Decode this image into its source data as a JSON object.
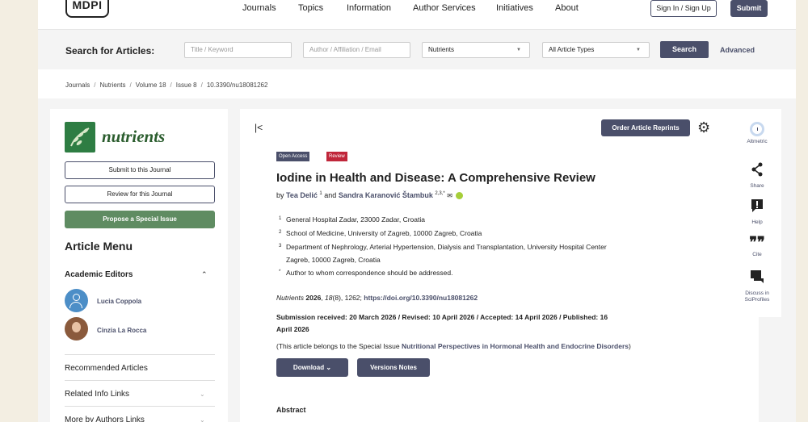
{
  "nav": {
    "logo": "MDPI",
    "links": [
      "Journals",
      "Topics",
      "Information",
      "Author Services",
      "Initiatives",
      "About"
    ],
    "sign_in": "Sign In / Sign Up",
    "submit": "Submit"
  },
  "search": {
    "label": "Search for Articles:",
    "keyword_placeholder": "Title / Keyword",
    "author_placeholder": "Author / Affiliation / Email",
    "journal_value": "Nutrients",
    "type_value": "All Article Types",
    "search_button": "Search",
    "advanced": "Advanced"
  },
  "breadcrumb": [
    "Journals",
    "Nutrients",
    "Volume 18",
    "Issue 8",
    "10.3390/nu18081262"
  ],
  "sidebar": {
    "journal_name": "nutrients",
    "submit_btn": "Submit to this Journal",
    "review_btn": "Review for this Journal",
    "propose_btn": "Propose a Special Issue",
    "menu_title": "Article Menu",
    "academic_editors": "Academic Editors",
    "editors": [
      "Lucia Coppola",
      "Cinzia La Rocca"
    ],
    "links": [
      "Recommended Articles",
      "Related Info Links",
      "More by Authors Links"
    ]
  },
  "article": {
    "collapse_icon": "|<",
    "order_reprints": "Order Article Reprints",
    "badge_oa": "Open Access",
    "badge_review": "Review",
    "title": "Iodine in Health and Disease: A Comprehensive Review",
    "by": "by",
    "author1": "Tea Delić",
    "author1_sup": "1",
    "and": "and",
    "author2": "Sandra Karanović Štambuk",
    "author2_sup": "2,3,*",
    "affiliations": [
      {
        "num": "1",
        "text": "General Hospital Zadar, 23000 Zadar, Croatia"
      },
      {
        "num": "2",
        "text": "School of Medicine, University of Zagreb, 10000 Zagreb, Croatia"
      },
      {
        "num": "3",
        "text": "Department of Nephrology, Arterial Hypertension, Dialysis and Transplantation, University Hospital Center"
      },
      {
        "num": "",
        "text": "Zagreb, 10000 Zagreb, Croatia"
      },
      {
        "num": "*",
        "text": "Author to whom correspondence should be addressed."
      }
    ],
    "cite_journal": "Nutrients",
    "cite_year": "2026",
    "cite_vol": "18",
    "cite_rest": "(8), 1262; ",
    "doi": "https://doi.org/10.3390/nu18081262",
    "dates": "Submission received: 20 March 2026 / Revised: 10 April 2026 / Accepted: 14 April 2026 / Published: 16 April 2026",
    "special_prefix": "(This article belongs to the Special Issue ",
    "special_issue": "Nutritional Perspectives in Hormonal Health and Endocrine Disorders",
    "special_suffix": ")",
    "download": "Download",
    "versions": "Versions Notes",
    "abstract": "Abstract"
  },
  "rail": {
    "altmetric": "Altmetric",
    "share": "Share",
    "help": "Help",
    "cite": "Cite",
    "discuss": "Discuss in SciProfiles"
  }
}
